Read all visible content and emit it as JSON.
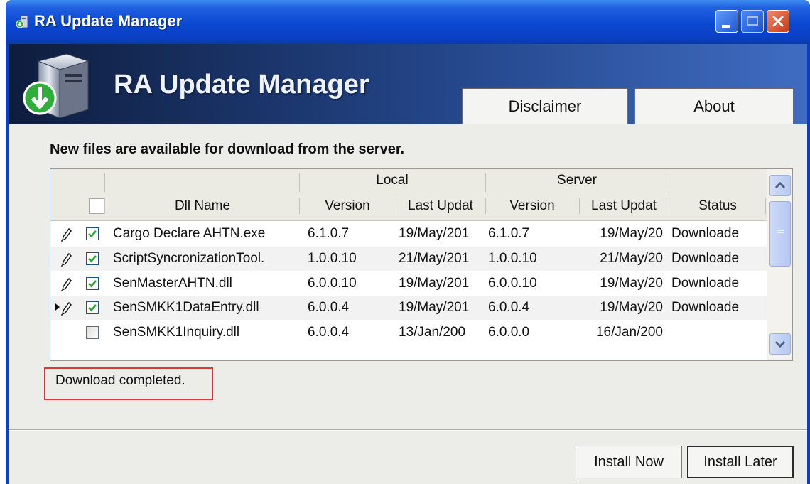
{
  "window": {
    "title": "RA Update Manager",
    "title_icon": "app-update-icon",
    "controls": [
      "minimize",
      "maximize",
      "close"
    ]
  },
  "banner": {
    "title": "RA Update Manager",
    "icon": "download-server-icon",
    "disclaimer_label": "Disclaimer",
    "about_label": "About"
  },
  "info_text": "New files are available for download from the server.",
  "grid": {
    "group_headers": {
      "local": "Local",
      "server": "Server"
    },
    "columns": {
      "dll_name": "Dll Name",
      "local_version": "Version",
      "local_last_update": "Last Updat",
      "server_version": "Version",
      "server_last_update": "Last Updat",
      "status": "Status"
    },
    "rows": [
      {
        "editing": true,
        "current": false,
        "checked": true,
        "dll_name": "Cargo Declare AHTN.exe",
        "local_version": "6.1.0.7",
        "local_last_update": "19/May/201",
        "server_version": "6.1.0.7",
        "server_last_update": "19/May/20",
        "status": "Downloade"
      },
      {
        "editing": true,
        "current": false,
        "checked": true,
        "dll_name": "ScriptSyncronizationTool.",
        "local_version": "1.0.0.10",
        "local_last_update": "21/May/201",
        "server_version": "1.0.0.10",
        "server_last_update": "21/May/20",
        "status": "Downloade"
      },
      {
        "editing": true,
        "current": false,
        "checked": true,
        "dll_name": "SenMasterAHTN.dll",
        "local_version": "6.0.0.10",
        "local_last_update": "19/May/201",
        "server_version": "6.0.0.10",
        "server_last_update": "19/May/20",
        "status": "Downloade"
      },
      {
        "editing": true,
        "current": true,
        "checked": true,
        "dll_name": "SenSMKK1DataEntry.dll",
        "local_version": "6.0.0.4",
        "local_last_update": "19/May/201",
        "server_version": "6.0.0.4",
        "server_last_update": "19/May/20",
        "status": "Downloade"
      },
      {
        "editing": false,
        "current": false,
        "checked": false,
        "dll_name": "SenSMKK1Inquiry.dll",
        "local_version": "6.0.0.4",
        "local_last_update": "13/Jan/200",
        "server_version": "6.0.0.0",
        "server_last_update": "16/Jan/200",
        "status": ""
      }
    ]
  },
  "status_message": "Download completed.",
  "footer": {
    "install_now_label": "Install Now",
    "install_later_label": "Install Later"
  },
  "colors": {
    "titlebar": "#0a48d2",
    "banner_dark": "#0e1d3e",
    "status_border": "#d63a3a",
    "checkbox_check": "#2ba52b"
  }
}
